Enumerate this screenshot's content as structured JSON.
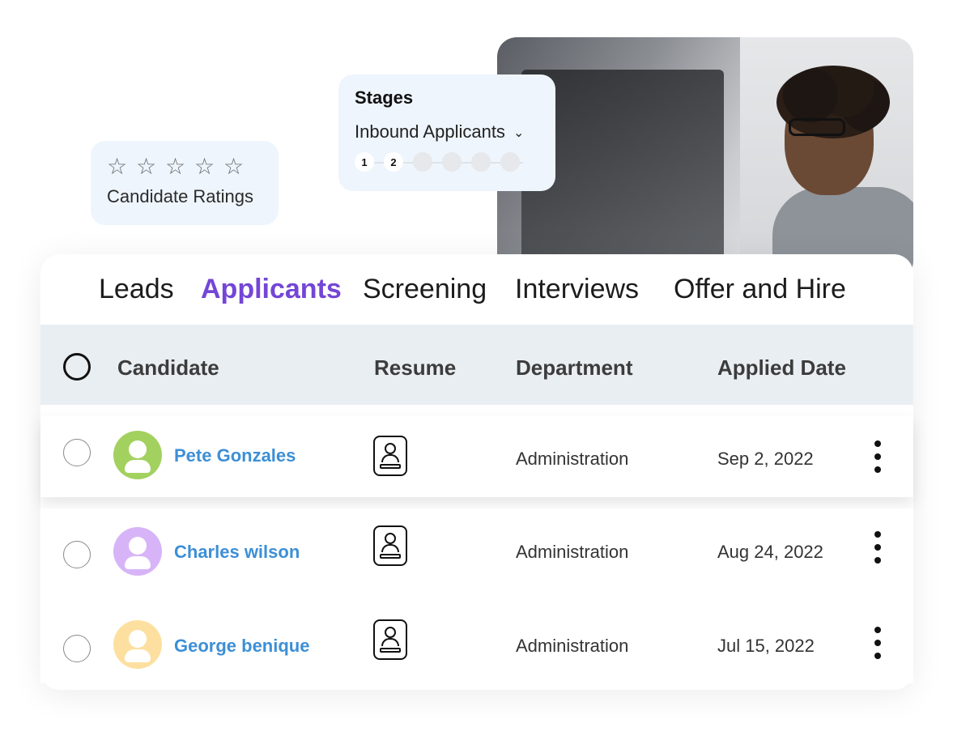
{
  "ratings_card": {
    "stars": [
      "☆",
      "☆",
      "☆",
      "☆",
      "☆"
    ],
    "label": "Candidate Ratings"
  },
  "stages_card": {
    "title": "Stages",
    "selected_stage": "Inbound Applicants",
    "steps": [
      "1",
      "2",
      "",
      "",
      "",
      ""
    ]
  },
  "tabs": [
    {
      "label": "Leads",
      "active": false
    },
    {
      "label": "Applicants",
      "active": true
    },
    {
      "label": "Screening",
      "active": false
    },
    {
      "label": "Interviews",
      "active": false
    },
    {
      "label": "Offer and Hire",
      "active": false
    }
  ],
  "table": {
    "columns": [
      "Candidate",
      "Resume",
      "Department",
      "Applied Date"
    ],
    "rows": [
      {
        "name": "Pete Gonzales",
        "avatar_color": "#a3d160",
        "department": "Administration",
        "applied": "Sep 2, 2022"
      },
      {
        "name": "Charles wilson",
        "avatar_color": "#d7b4f7",
        "department": "Administration",
        "applied": "Aug 24, 2022"
      },
      {
        "name": "George benique",
        "avatar_color": "#fde0a0",
        "department": "Administration",
        "applied": "Jul 15, 2022"
      }
    ]
  },
  "colors": {
    "accent": "#7446d6",
    "link": "#3d8fd6",
    "card_bg": "#eef5fc",
    "header_bg": "#e9eef2"
  },
  "icons": {
    "resume": "resume-icon",
    "more": "kebab-menu-icon",
    "chevron": "chevron-down-icon",
    "star": "star-outline-icon"
  }
}
